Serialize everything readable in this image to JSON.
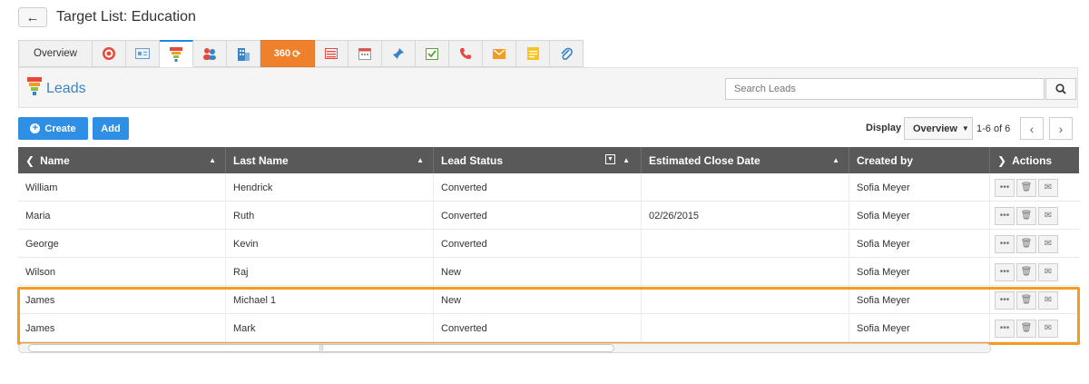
{
  "header": {
    "back_icon": "back-arrow-icon",
    "title": "Target List: Education"
  },
  "tabs": [
    {
      "label": "Overview",
      "icon": ""
    },
    {
      "label": "",
      "icon": "target-icon"
    },
    {
      "label": "",
      "icon": "contact-card-icon"
    },
    {
      "label": "",
      "icon": "funnel-icon"
    },
    {
      "label": "",
      "icon": "users-icon"
    },
    {
      "label": "",
      "icon": "building-icon"
    },
    {
      "label": "360",
      "icon": "refresh-icon"
    },
    {
      "label": "",
      "icon": "list-icon"
    },
    {
      "label": "",
      "icon": "calendar-icon"
    },
    {
      "label": "",
      "icon": "pin-icon"
    },
    {
      "label": "",
      "icon": "task-icon"
    },
    {
      "label": "",
      "icon": "phone-icon"
    },
    {
      "label": "",
      "icon": "email-icon"
    },
    {
      "label": "",
      "icon": "note-icon"
    },
    {
      "label": "",
      "icon": "attachment-icon"
    }
  ],
  "panel": {
    "title": "Leads",
    "search_placeholder": "Search Leads"
  },
  "toolbar": {
    "create_label": "Create",
    "add_label": "Add",
    "display_label": "Display",
    "display_value": "Overview",
    "pager_text": "1-6 of 6"
  },
  "table": {
    "columns": [
      "Name",
      "Last Name",
      "Lead Status",
      "Estimated Close Date",
      "Created by",
      "Actions"
    ],
    "rows": [
      {
        "name": "William",
        "last_name": "Hendrick",
        "status": "Converted",
        "close_date": "",
        "created_by": "Sofia Meyer"
      },
      {
        "name": "Maria",
        "last_name": "Ruth",
        "status": "Converted",
        "close_date": "02/26/2015",
        "created_by": "Sofia Meyer"
      },
      {
        "name": "George",
        "last_name": "Kevin",
        "status": "Converted",
        "close_date": "",
        "created_by": "Sofia Meyer"
      },
      {
        "name": "Wilson",
        "last_name": "Raj",
        "status": "New",
        "close_date": "",
        "created_by": "Sofia Meyer"
      },
      {
        "name": "James",
        "last_name": "Michael 1",
        "status": "New",
        "close_date": "",
        "created_by": "Sofia Meyer"
      },
      {
        "name": "James",
        "last_name": "Mark",
        "status": "Converted",
        "close_date": "",
        "created_by": "Sofia Meyer"
      }
    ]
  },
  "colors": {
    "accent": "#2f8fe5",
    "highlight": "#f29c22",
    "header_bg": "#595959",
    "title": "#3a84c6"
  }
}
